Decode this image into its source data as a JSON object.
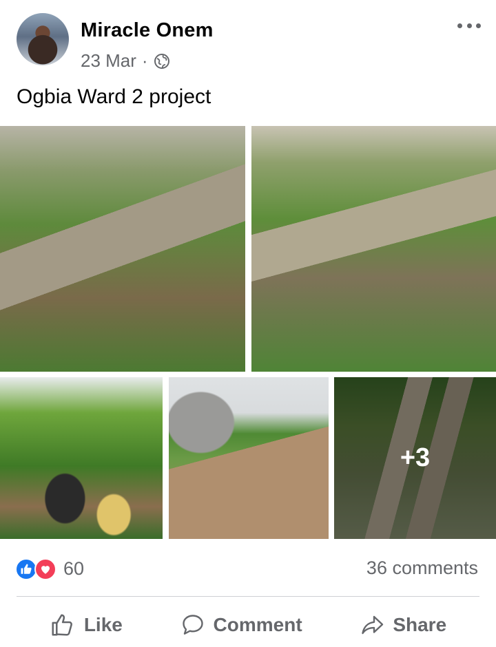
{
  "post": {
    "author": "Miracle Onem",
    "date": "23 Mar",
    "separator": "·",
    "privacy_icon": "globe-icon",
    "text": "Ogbia Ward 2 project",
    "more_photos_count": "+3"
  },
  "stats": {
    "reaction_icons": [
      "like-icon",
      "love-icon"
    ],
    "reaction_count": "60",
    "comments": "36 comments"
  },
  "actions": {
    "like": "Like",
    "comment": "Comment",
    "share": "Share"
  },
  "colors": {
    "like_blue": "#1877f2",
    "love_red": "#f33e58",
    "secondary_text": "#65676b"
  }
}
